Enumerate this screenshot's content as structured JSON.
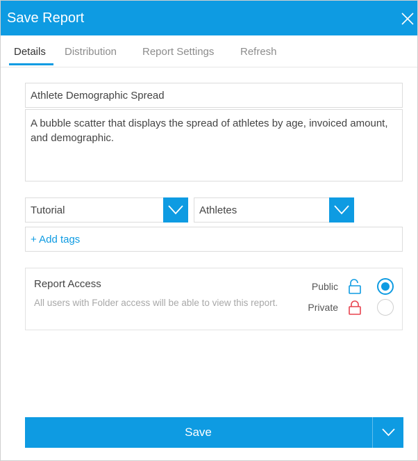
{
  "dialog": {
    "title": "Save Report"
  },
  "tabs": [
    {
      "label": "Details",
      "active": true
    },
    {
      "label": "Distribution",
      "active": false
    },
    {
      "label": "Report Settings",
      "active": false
    },
    {
      "label": "Refresh",
      "active": false
    }
  ],
  "form": {
    "name_value": "Athlete Demographic Spread",
    "description_value": "A bubble scatter that displays the spread of athletes by age, invoiced amount, and demographic.",
    "folder_value": "Tutorial",
    "subfolder_value": "Athletes",
    "add_tags_label": "+ Add tags"
  },
  "access": {
    "title": "Report Access",
    "description": "All users with Folder access will be able to view this report.",
    "options": [
      {
        "label": "Public",
        "icon": "unlock-icon",
        "selected": true,
        "color": "#0e9be2"
      },
      {
        "label": "Private",
        "icon": "lock-icon",
        "selected": false,
        "color": "#e8434f"
      }
    ]
  },
  "footer": {
    "save_label": "Save"
  },
  "colors": {
    "accent": "#0e9be2",
    "private": "#e8434f"
  }
}
